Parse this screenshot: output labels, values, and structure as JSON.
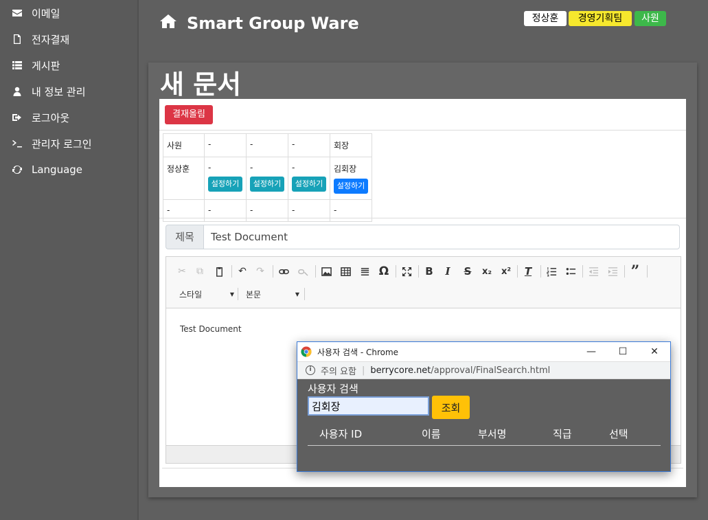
{
  "sidebar": {
    "items": [
      {
        "label": "이메일",
        "icon": "envelope-icon"
      },
      {
        "label": "전자결재",
        "icon": "document-icon"
      },
      {
        "label": "게시판",
        "icon": "list-icon"
      },
      {
        "label": "내 정보 관리",
        "icon": "user-icon"
      },
      {
        "label": "로그아웃",
        "icon": "sign-out-icon"
      },
      {
        "label": "관리자 로그인",
        "icon": "terminal-icon"
      },
      {
        "label": "Language",
        "icon": "refresh-icon"
      }
    ]
  },
  "header": {
    "brand": "Smart Group Ware",
    "user_badge": "정상훈",
    "dept_badge": "경영기획팀",
    "rank_badge": "사원"
  },
  "page": {
    "title": "새 문서",
    "approve_button": "결재올림"
  },
  "approval": {
    "rows": [
      [
        "사원",
        "-",
        "-",
        "-",
        "회장"
      ],
      [
        "정상훈",
        "-",
        "-",
        "-",
        "김회장"
      ],
      [
        "-",
        "-",
        "-",
        "-",
        "-"
      ]
    ],
    "set_button": "설정하기"
  },
  "form": {
    "subject_label": "제목",
    "subject_value": "Test Document"
  },
  "editor": {
    "style_combo": "스타일",
    "format_combo": "본문",
    "body_text": "Test Document"
  },
  "popup": {
    "window_title": "사용자 검색 - Chrome",
    "security_label": "주의 요함",
    "url_host": "berrycore.net",
    "url_path": "/approval/FinalSearch.html",
    "heading": "사용자 검색",
    "search_value": "김회장",
    "search_button": "조회",
    "columns": [
      "사용자 ID",
      "이름",
      "부서명",
      "직급",
      "선택"
    ]
  },
  "colors": {
    "background": "#5f5f5f",
    "danger": "#dc3545",
    "info": "#17a2b8",
    "primary": "#0d7bff",
    "warning": "#ffc107",
    "dept_badge": "#f6e82d",
    "rank_badge": "#3db84a"
  }
}
